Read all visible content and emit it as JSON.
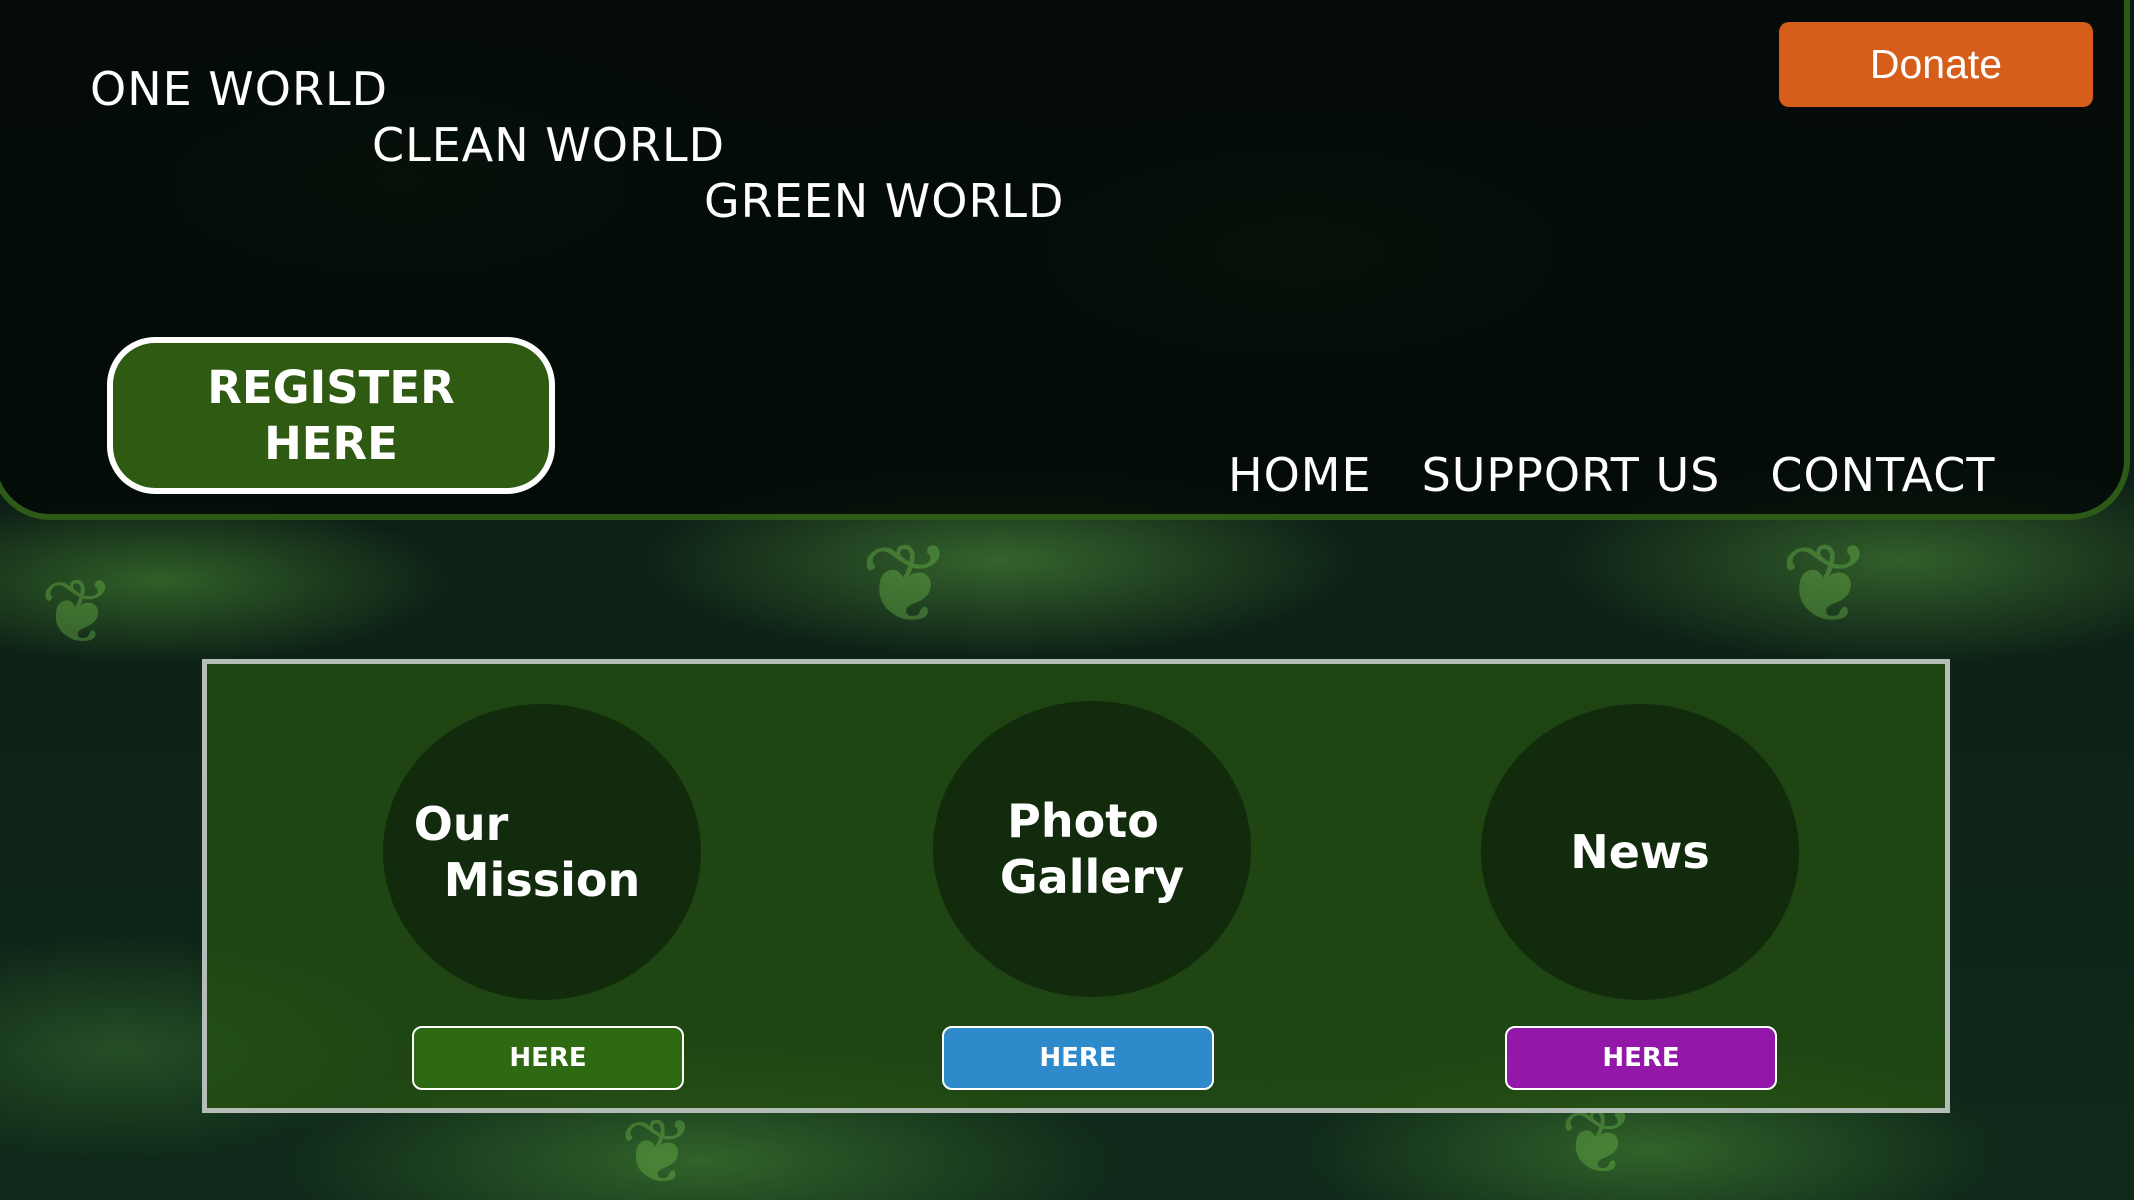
{
  "header": {
    "tagline_lines": [
      "ONE WORLD",
      "CLEAN WORLD",
      "GREEN WORLD"
    ],
    "donate_label": "Donate",
    "register_lines": [
      "REGISTER",
      "HERE"
    ],
    "nav": [
      "HOME",
      "SUPPORT US",
      "CONTACT"
    ]
  },
  "sections": [
    {
      "title_lines": [
        "Our",
        "Mission"
      ],
      "button_label": "HERE",
      "button_color": "#2e6a12"
    },
    {
      "title_lines": [
        "Photo",
        "Gallery"
      ],
      "button_label": "HERE",
      "button_color": "#2f8acb"
    },
    {
      "title_lines": [
        "News"
      ],
      "button_label": "HERE",
      "button_color": "#9317a9"
    }
  ],
  "colors": {
    "donate": "#d65e1a",
    "register": "#2e5a12",
    "header_border": "#2d5a17",
    "content_box_border": "#b5bdb8"
  },
  "background": "dark green fern foliage photo"
}
